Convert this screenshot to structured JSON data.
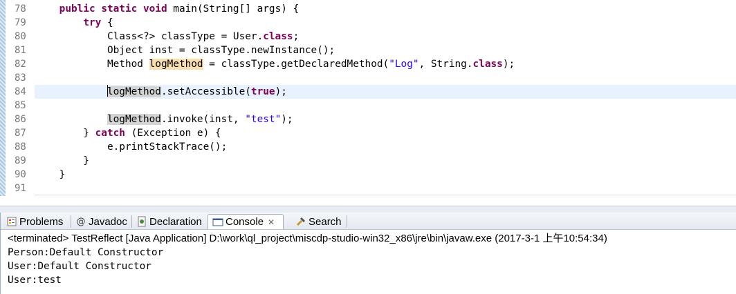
{
  "editor": {
    "lines": [
      {
        "num": "78",
        "segments": [
          [
            "    ",
            ""
          ],
          [
            "public",
            "kw"
          ],
          [
            " ",
            ""
          ],
          [
            "static",
            "kw"
          ],
          [
            " ",
            ""
          ],
          [
            "void",
            "kw"
          ],
          [
            " main(String[] args) {",
            ""
          ]
        ]
      },
      {
        "num": "79",
        "segments": [
          [
            "        ",
            ""
          ],
          [
            "try",
            "kw"
          ],
          [
            " {",
            ""
          ]
        ]
      },
      {
        "num": "80",
        "segments": [
          [
            "            Class<?> classType = User.",
            ""
          ],
          [
            "class",
            "kw"
          ],
          [
            ";",
            ""
          ]
        ]
      },
      {
        "num": "81",
        "segments": [
          [
            "            Object inst = classType.newInstance();",
            ""
          ]
        ]
      },
      {
        "num": "82",
        "segments": [
          [
            "            Method ",
            ""
          ],
          [
            "logMethod",
            "occ-w"
          ],
          [
            " = classType.getDeclaredMethod(",
            ""
          ],
          [
            "\"Log\"",
            "str"
          ],
          [
            ", String.",
            ""
          ],
          [
            "class",
            "kw"
          ],
          [
            ");",
            ""
          ]
        ]
      },
      {
        "num": "83",
        "segments": []
      },
      {
        "num": "84",
        "segments": [
          [
            "            ",
            ""
          ],
          [
            "logMethod",
            "occ-r caret"
          ],
          [
            ".setAccessible(",
            ""
          ],
          [
            "true",
            "kw"
          ],
          [
            ");",
            ""
          ]
        ],
        "current": true
      },
      {
        "num": "85",
        "segments": []
      },
      {
        "num": "86",
        "segments": [
          [
            "            ",
            ""
          ],
          [
            "logMethod",
            "occ-r"
          ],
          [
            ".invoke(inst, ",
            ""
          ],
          [
            "\"test\"",
            "str"
          ],
          [
            ");",
            ""
          ]
        ]
      },
      {
        "num": "87",
        "segments": [
          [
            "        } ",
            ""
          ],
          [
            "catch",
            "kw"
          ],
          [
            " (Exception e) {",
            ""
          ]
        ]
      },
      {
        "num": "88",
        "segments": [
          [
            "            e.printStackTrace();",
            ""
          ]
        ]
      },
      {
        "num": "89",
        "segments": [
          [
            "        }",
            ""
          ]
        ]
      },
      {
        "num": "90",
        "segments": [
          [
            "    }",
            ""
          ]
        ]
      },
      {
        "num": "91",
        "segments": []
      }
    ]
  },
  "views": {
    "tabs": [
      {
        "label": "Problems",
        "icon": "problems-icon"
      },
      {
        "label": "Javadoc",
        "icon": "javadoc-icon"
      },
      {
        "label": "Declaration",
        "icon": "declaration-icon"
      },
      {
        "label": "Console",
        "icon": "console-icon",
        "active": true
      },
      {
        "label": "Search",
        "icon": "search-icon"
      }
    ],
    "console": {
      "terminated_line": "<terminated> TestReflect [Java Application] D:\\work\\ql_project\\miscdp-studio-win32_x86\\jre\\bin\\javaw.exe (2017-3-1 上午10:54:34)",
      "output": [
        "Person:Default Constructor",
        "User:Default Constructor",
        "User:test"
      ]
    }
  },
  "colors": {
    "keyword": "#7f0055",
    "string": "#2a00ff",
    "line_number": "#787878",
    "current_line": "#e8f2fe"
  }
}
